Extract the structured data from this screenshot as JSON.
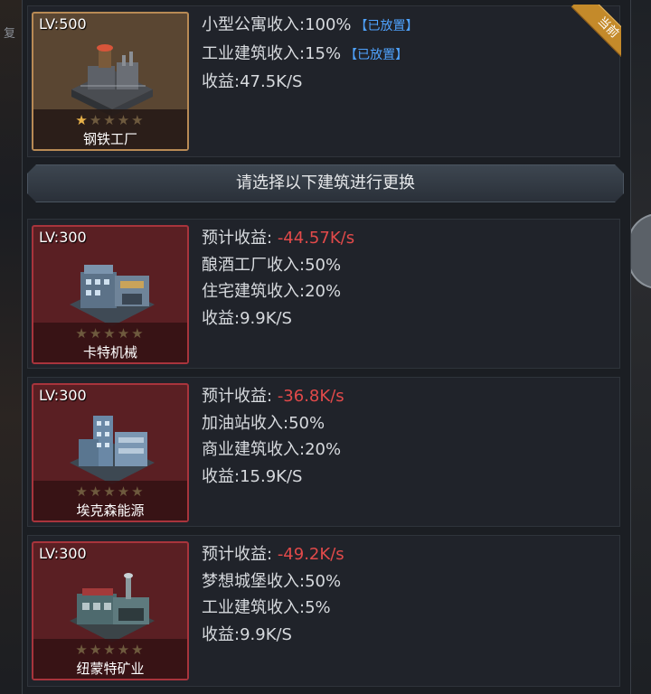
{
  "background": {
    "left_char": "复"
  },
  "current": {
    "level": "LV:500",
    "name": "钢铁工厂",
    "stars_on": 1,
    "stars_total": 5,
    "badge": "当前",
    "lines": [
      "小型公寓收入:100%",
      "工业建筑收入:15%",
      "收益:47.5K/S"
    ],
    "placed_tags": [
      "【已放置】",
      "【已放置】"
    ]
  },
  "select_prompt": "请选择以下建筑进行更换",
  "candidates": [
    {
      "level": "LV:300",
      "name": "卡特机械",
      "forecast_label": "预计收益:",
      "forecast_value": "-44.57K/s",
      "lines": [
        "酿酒工厂收入:50%",
        "住宅建筑收入:20%",
        "收益:9.9K/S"
      ]
    },
    {
      "level": "LV:300",
      "name": "埃克森能源",
      "forecast_label": "预计收益:",
      "forecast_value": "-36.8K/s",
      "lines": [
        "加油站收入:50%",
        "商业建筑收入:20%",
        "收益:15.9K/S"
      ]
    },
    {
      "level": "LV:300",
      "name": "纽蒙特矿业",
      "forecast_label": "预计收益:",
      "forecast_value": "-49.2K/s",
      "lines": [
        "梦想城堡收入:50%",
        "工业建筑收入:5%",
        "收益:9.9K/S"
      ]
    }
  ],
  "colors": {
    "negative": "#e24a4a",
    "placed": "#4fa3ff",
    "star_on": "#e8b24a",
    "star_off": "#6e5a3e"
  }
}
